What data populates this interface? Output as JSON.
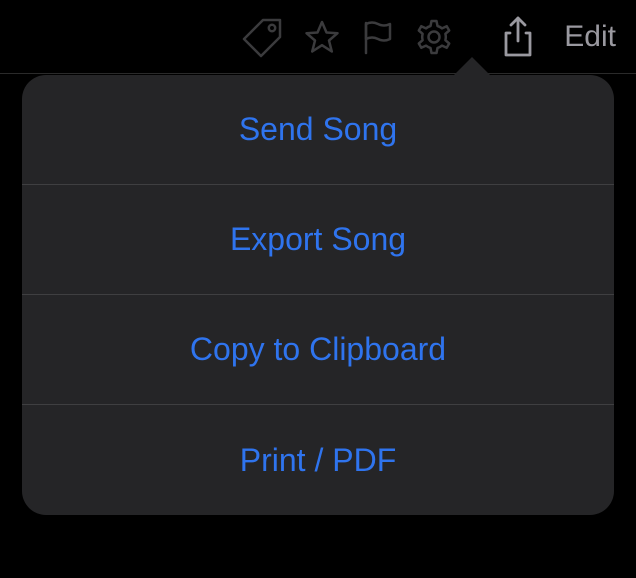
{
  "toolbar": {
    "edit_label": "Edit"
  },
  "share_menu": {
    "items": [
      {
        "label": "Send Song"
      },
      {
        "label": "Export Song"
      },
      {
        "label": "Copy to Clipboard"
      },
      {
        "label": "Print / PDF"
      }
    ]
  }
}
